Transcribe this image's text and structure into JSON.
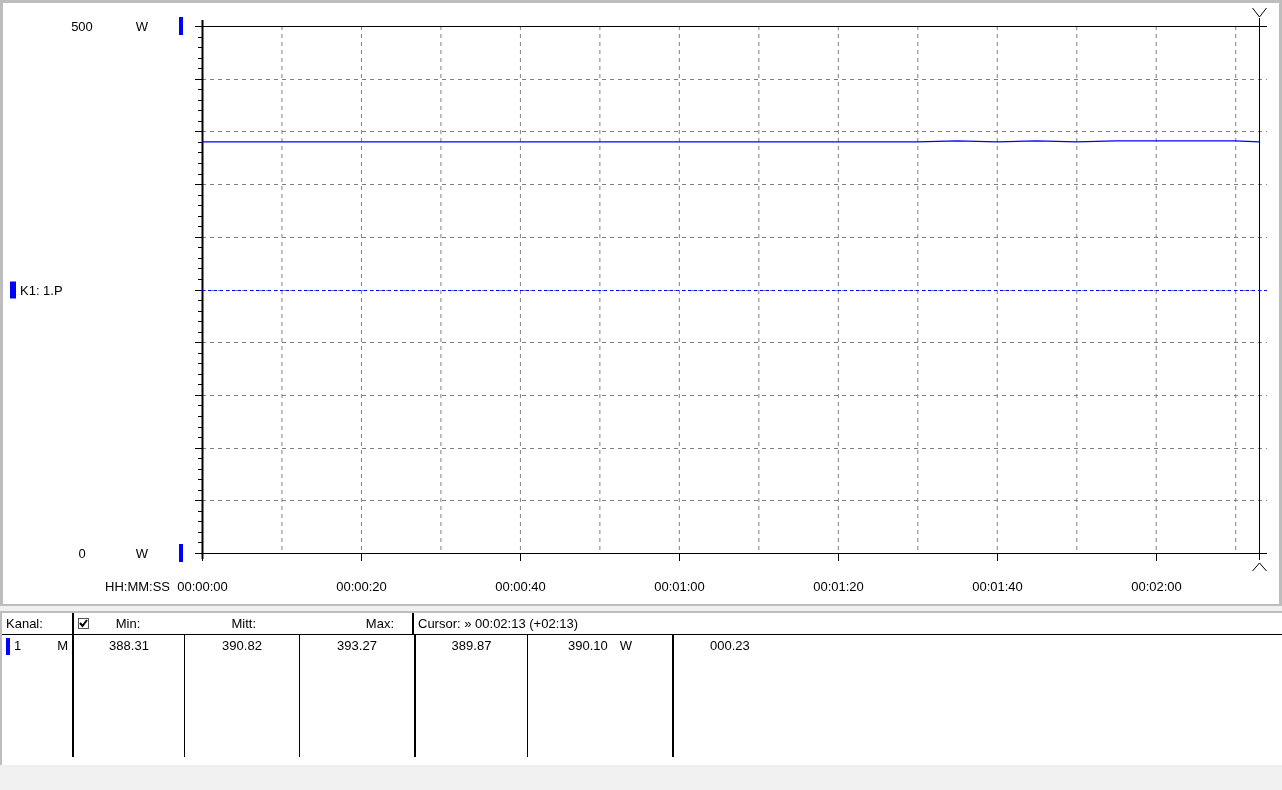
{
  "chart_panel": {
    "units": [
      "W",
      "W"
    ],
    "chart_data": {
      "type": "line",
      "xlabel": "HH:MM:SS",
      "xlim": [
        0,
        134
      ],
      "ylim": [
        0,
        500
      ],
      "grid": true,
      "yticks": [
        {
          "value": 500,
          "label": "500"
        },
        {
          "value": 0,
          "label": "0"
        }
      ],
      "xticks": [
        {
          "value": 0,
          "label": "00:00:00"
        },
        {
          "value": 20,
          "label": "00:00:20"
        },
        {
          "value": 40,
          "label": "00:00:40"
        },
        {
          "value": 60,
          "label": "00:01:00"
        },
        {
          "value": 80,
          "label": "00:01:20"
        },
        {
          "value": 100,
          "label": "00:01:40"
        },
        {
          "value": 120,
          "label": "00:02:00"
        }
      ],
      "x": [
        0,
        5,
        10,
        15,
        20,
        25,
        30,
        35,
        40,
        45,
        50,
        55,
        60,
        65,
        70,
        75,
        80,
        85,
        90,
        95,
        100,
        105,
        110,
        115,
        120,
        125,
        130,
        133
      ],
      "series": [
        {
          "name": "K1: 1.P",
          "color": "#0000ff",
          "values": [
            390,
            390,
            390,
            390,
            390,
            390,
            390,
            390,
            390,
            390,
            390,
            390,
            390,
            390,
            390,
            390,
            390,
            390,
            390,
            391,
            390,
            391,
            390,
            391,
            391,
            391,
            391,
            390
          ]
        }
      ],
      "ref_lines": [
        {
          "axis": "y",
          "value": 250,
          "color": "#0000ff"
        },
        {
          "axis": "x",
          "value": 133
        }
      ]
    }
  },
  "table": {
    "header": {
      "kanal": "Kanal:",
      "checked": true,
      "min": "Min:",
      "mitt": "Mitt:",
      "max": "Max:",
      "cursor": "Cursor: » 00:02:13 (+02:13)"
    },
    "rows": [
      {
        "color": "#0000ff",
        "channel": "1",
        "mode": "M",
        "min": "388.31",
        "mitt": "390.82",
        "max": "393.27",
        "cursor_value": "389.87",
        "value": "390.10",
        "unit": "W",
        "delta": "000.23"
      }
    ]
  }
}
